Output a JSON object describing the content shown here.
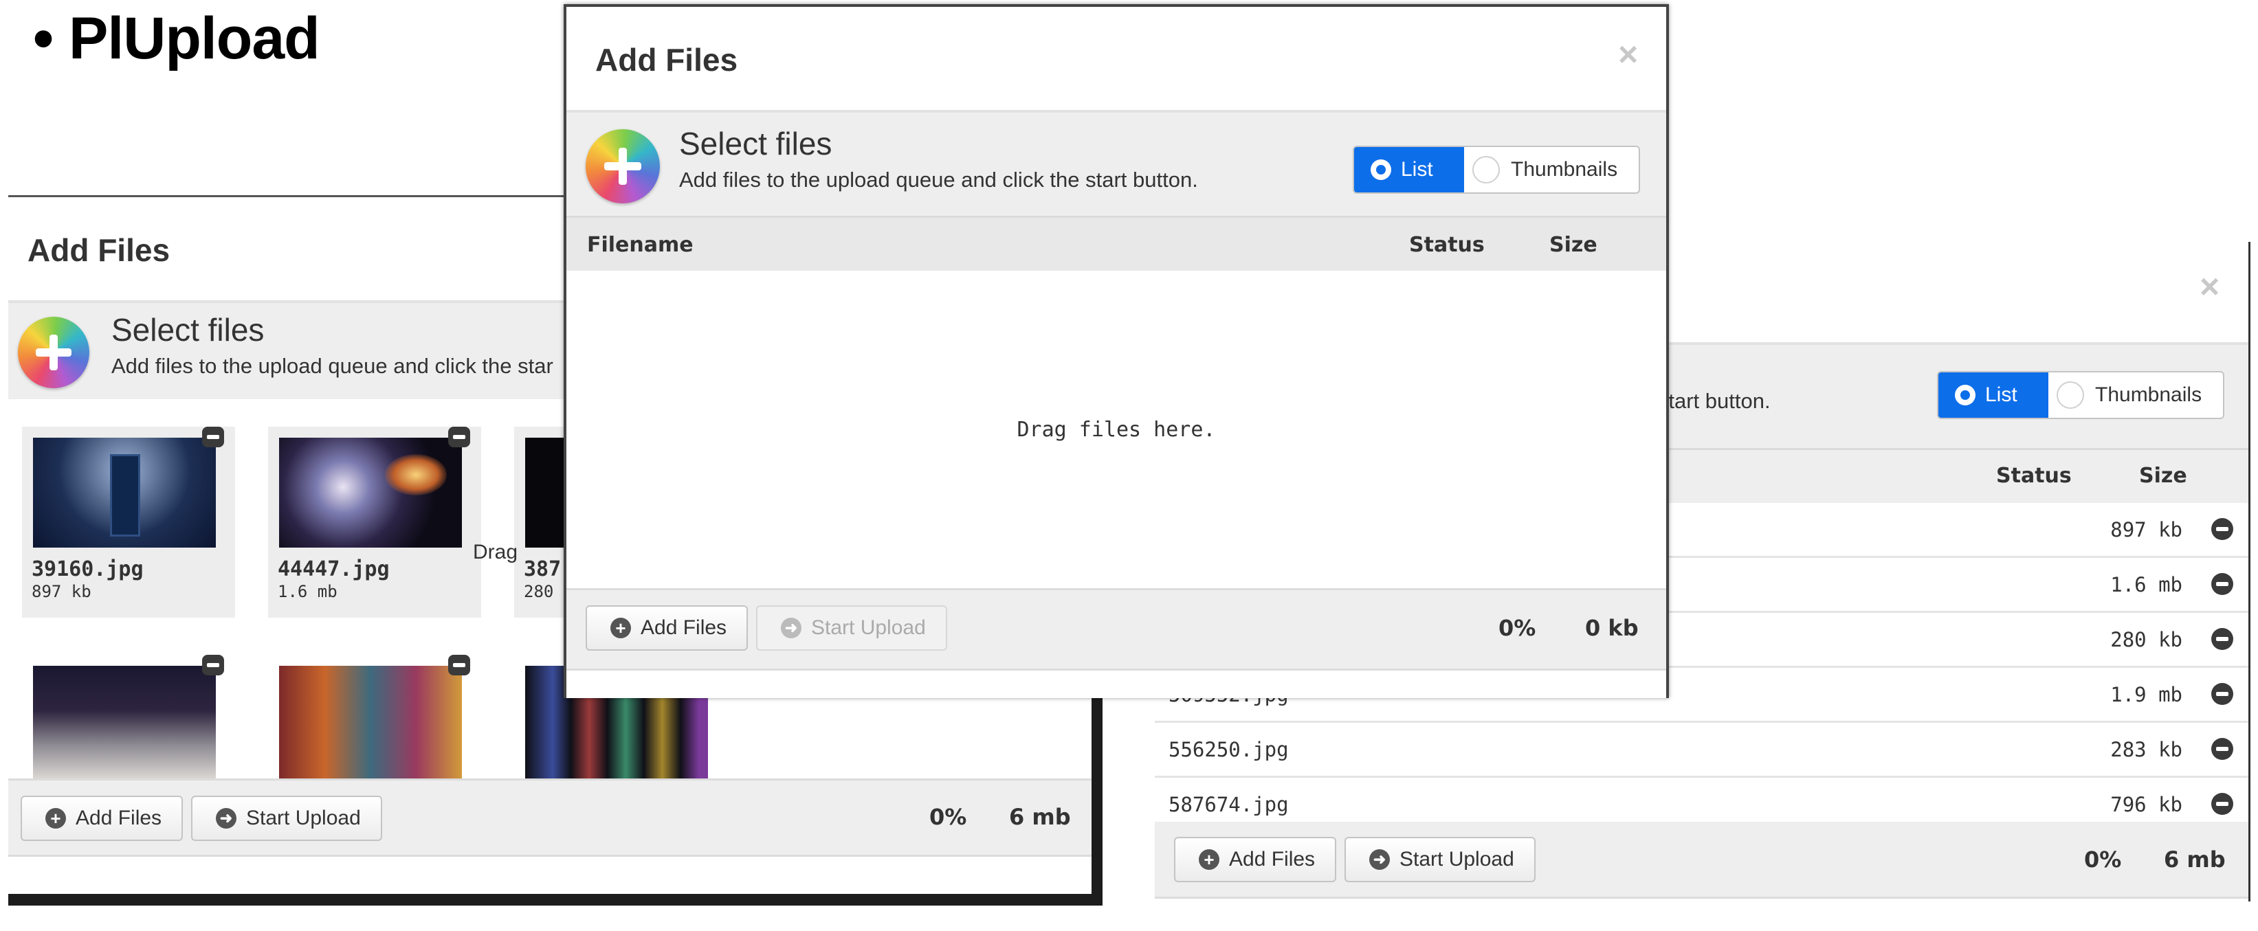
{
  "slide": {
    "bullet": "• PlUpload"
  },
  "left_window": {
    "title": "Add Files",
    "select_title": "Select files",
    "select_sub": "Add files to the upload queue and click the star",
    "thumbs": [
      {
        "name": "39160.jpg",
        "size": "897 kb",
        "icon": "tardis-image"
      },
      {
        "name": "44447.jpg",
        "size": "1.6 mb",
        "icon": "nebula-image"
      },
      {
        "name": "387",
        "size": "280",
        "icon": "dark-image"
      },
      {
        "name": "",
        "size": "",
        "icon": "crowd-image"
      },
      {
        "name": "",
        "size": "",
        "icon": "collage-image"
      },
      {
        "name": "",
        "size": "",
        "icon": "doctors-image"
      }
    ],
    "drag_partial": "Drag",
    "add_files_label": "Add Files",
    "start_upload_label": "Start Upload",
    "percent": "0%",
    "total_size": "6 mb"
  },
  "middle_window": {
    "title": "Add Files",
    "close": "×",
    "select_title": "Select files",
    "select_sub": "Add files to the upload queue and click the start button.",
    "toggle_list": "List",
    "toggle_thumbs": "Thumbnails",
    "col_filename": "Filename",
    "col_status": "Status",
    "col_size": "Size",
    "drop_text": "Drag files here.",
    "add_files_label": "Add Files",
    "start_upload_label": "Start Upload",
    "percent": "0%",
    "total_size": "0 kb"
  },
  "right_window": {
    "close": "×",
    "select_sub_partial": "e start button.",
    "toggle_list": "List",
    "toggle_thumbs": "Thumbnails",
    "col_status": "Status",
    "col_size": "Size",
    "rows": [
      {
        "name": "",
        "size": "897 kb"
      },
      {
        "name": "",
        "size": "1.6 mb"
      },
      {
        "name": "",
        "size": "280 kb"
      },
      {
        "name": "509552.jpg",
        "size": "1.9 mb"
      },
      {
        "name": "556250.jpg",
        "size": "283 kb"
      },
      {
        "name": "587674.jpg",
        "size": "796 kb"
      }
    ],
    "add_files_label": "Add Files",
    "start_upload_label": "Start Upload",
    "percent": "0%",
    "total_size": "6 mb"
  },
  "colors": {
    "accent": "#0d6ee9",
    "band": "#eeeeee",
    "text": "#333333"
  }
}
